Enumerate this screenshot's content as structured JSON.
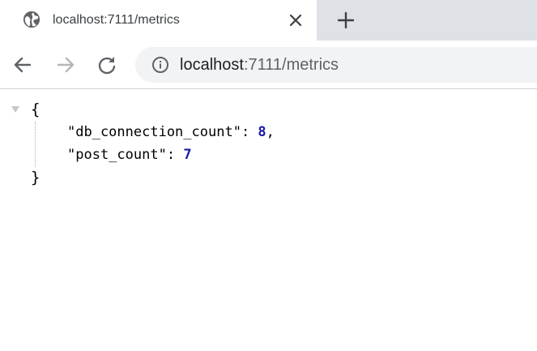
{
  "tab": {
    "title": "localhost:7111/metrics",
    "favicon": "globe-icon"
  },
  "toolbar": {
    "url_host": "localhost",
    "url_rest": ":7111/metrics"
  },
  "json": {
    "open_brace": "{",
    "close_brace": "}",
    "entries": [
      {
        "key": "\"db_connection_count\"",
        "sep": ": ",
        "value": "8",
        "trail": ","
      },
      {
        "key": "\"post_count\"",
        "sep": ": ",
        "value": "7",
        "trail": ""
      }
    ]
  },
  "colors": {
    "tabstrip_bg": "#dee1e6",
    "omnibox_bg": "#f1f3f4",
    "json_number": "#1a1aa6"
  }
}
